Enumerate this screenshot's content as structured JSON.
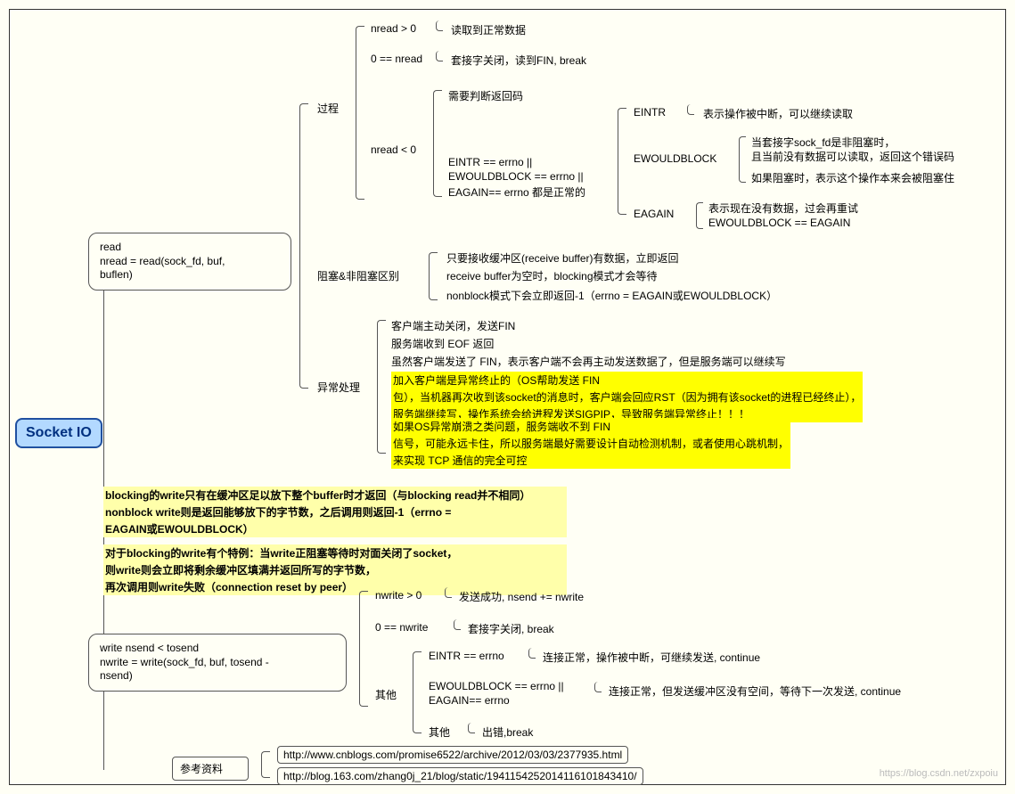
{
  "root": {
    "title": "Socket IO"
  },
  "read": {
    "box_l1": "read",
    "box_l2": "nread = read(sock_fd, buf,",
    "box_l3": "buflen)",
    "proc": {
      "label": "过程"
    },
    "blk": {
      "label": "阻塞&非阻塞区别"
    },
    "exc": {
      "label": "异常处理"
    },
    "nread_gt0": {
      "cond": "nread > 0",
      "desc": "读取到正常数据"
    },
    "nread_eq0": {
      "cond": "0 == nread",
      "desc": "套接字关闭，读到FIN, break"
    },
    "nread_lt0": {
      "cond": "nread < 0",
      "need_code": "需要判断返回码",
      "err_cond_l1": "EINTR == errno ||",
      "err_cond_l2": "EWOULDBLOCK == errno ||",
      "err_cond_l3": "EAGAIN== errno 都是正常的",
      "eintr": {
        "name": "EINTR",
        "desc": "表示操作被中断，可以继续读取"
      },
      "ewb": {
        "name": "EWOULDBLOCK",
        "desc_l1": "当套接字sock_fd是非阻塞时，",
        "desc_l2": "且当前没有数据可以读取，返回这个错误码",
        "desc_l3": "如果阻塞时，表示这个操作本来会被阻塞住"
      },
      "eagain": {
        "name": "EAGAIN",
        "desc_l1": "表示现在没有数据，过会再重试",
        "desc_l2": "EWOULDBLOCK == EAGAIN"
      }
    },
    "blk_l1": "只要接收缓冲区(receive buffer)有数据，立即返回",
    "blk_l2": "receive buffer为空时，blocking模式才会等待",
    "blk_l3": "nonblock模式下会立即返回-1（errno = EAGAIN或EWOULDBLOCK）",
    "exc_l1": "客户端主动关闭，发送FIN",
    "exc_l2": "服务端收到 EOF 返回",
    "exc_l3": "虽然客户端发送了 FIN，表示客户端不会再主动发送数据了，但是服务端可以继续写",
    "exc_h1_l1": "加入客户端是异常终止的（OS帮助发送 FIN",
    "exc_h1_l2": "包），当机器再次收到该socket的消息时，客户端会回应RST（因为拥有该socket的进程已经终止），",
    "exc_h1_l3": "服务端继续写，操作系统会给进程发送SIGPIP，导致服务端异常终止！！！",
    "exc_h2_l1": "如果OS异常崩溃之类问题，服务端收不到 FIN",
    "exc_h2_l2": "信号，可能永远卡住，所以服务端最好需要设计自动检测机制，或者使用心跳机制，",
    "exc_h2_l3": "来实现 TCP 通信的完全可控"
  },
  "write": {
    "note_l1": "blocking的write只有在缓冲区足以放下整个buffer时才返回（与blocking read并不相同）",
    "note_l2": "nonblock write则是返回能够放下的字节数，之后调用则返回-1（errno =",
    "note_l3": "EAGAIN或EWOULDBLOCK）",
    "note_l4": " 对于blocking的write有个特例：当write正阻塞等待时对面关闭了socket，",
    "note_l5": "则write则会立即将剩余缓冲区填满并返回所写的字节数，",
    "note_l6": "再次调用则write失败（connection reset by peer）",
    "box_l1": "write    nsend < tosend",
    "box_l2": "nwrite = write(sock_fd, buf, tosend -",
    "box_l3": "nsend)",
    "nw_gt0": {
      "cond": "nwrite > 0",
      "desc": "发送成功, nsend += nwrite"
    },
    "nw_eq0": {
      "cond": "0 == nwrite",
      "desc": "套接字关闭, break"
    },
    "other": {
      "label": "其他"
    },
    "eintr": {
      "cond": "EINTR == errno",
      "desc": "连接正常，操作被中断，可继续发送, continue"
    },
    "ewb": {
      "cond_l1": "EWOULDBLOCK == errno ||",
      "cond_l2": "EAGAIN== errno",
      "desc": "连接正常，但发送缓冲区没有空间，等待下一次发送, continue"
    },
    "other2": {
      "cond": "其他",
      "desc": "出错,break"
    }
  },
  "refs": {
    "label": "参考资料",
    "url1": "http://www.cnblogs.com/promise6522/archive/2012/03/03/2377935.html",
    "url2": "http://blog.163.com/zhang0j_21/blog/static/1941154252014116101843410/"
  },
  "watermark": "https://blog.csdn.net/zxpoiu"
}
